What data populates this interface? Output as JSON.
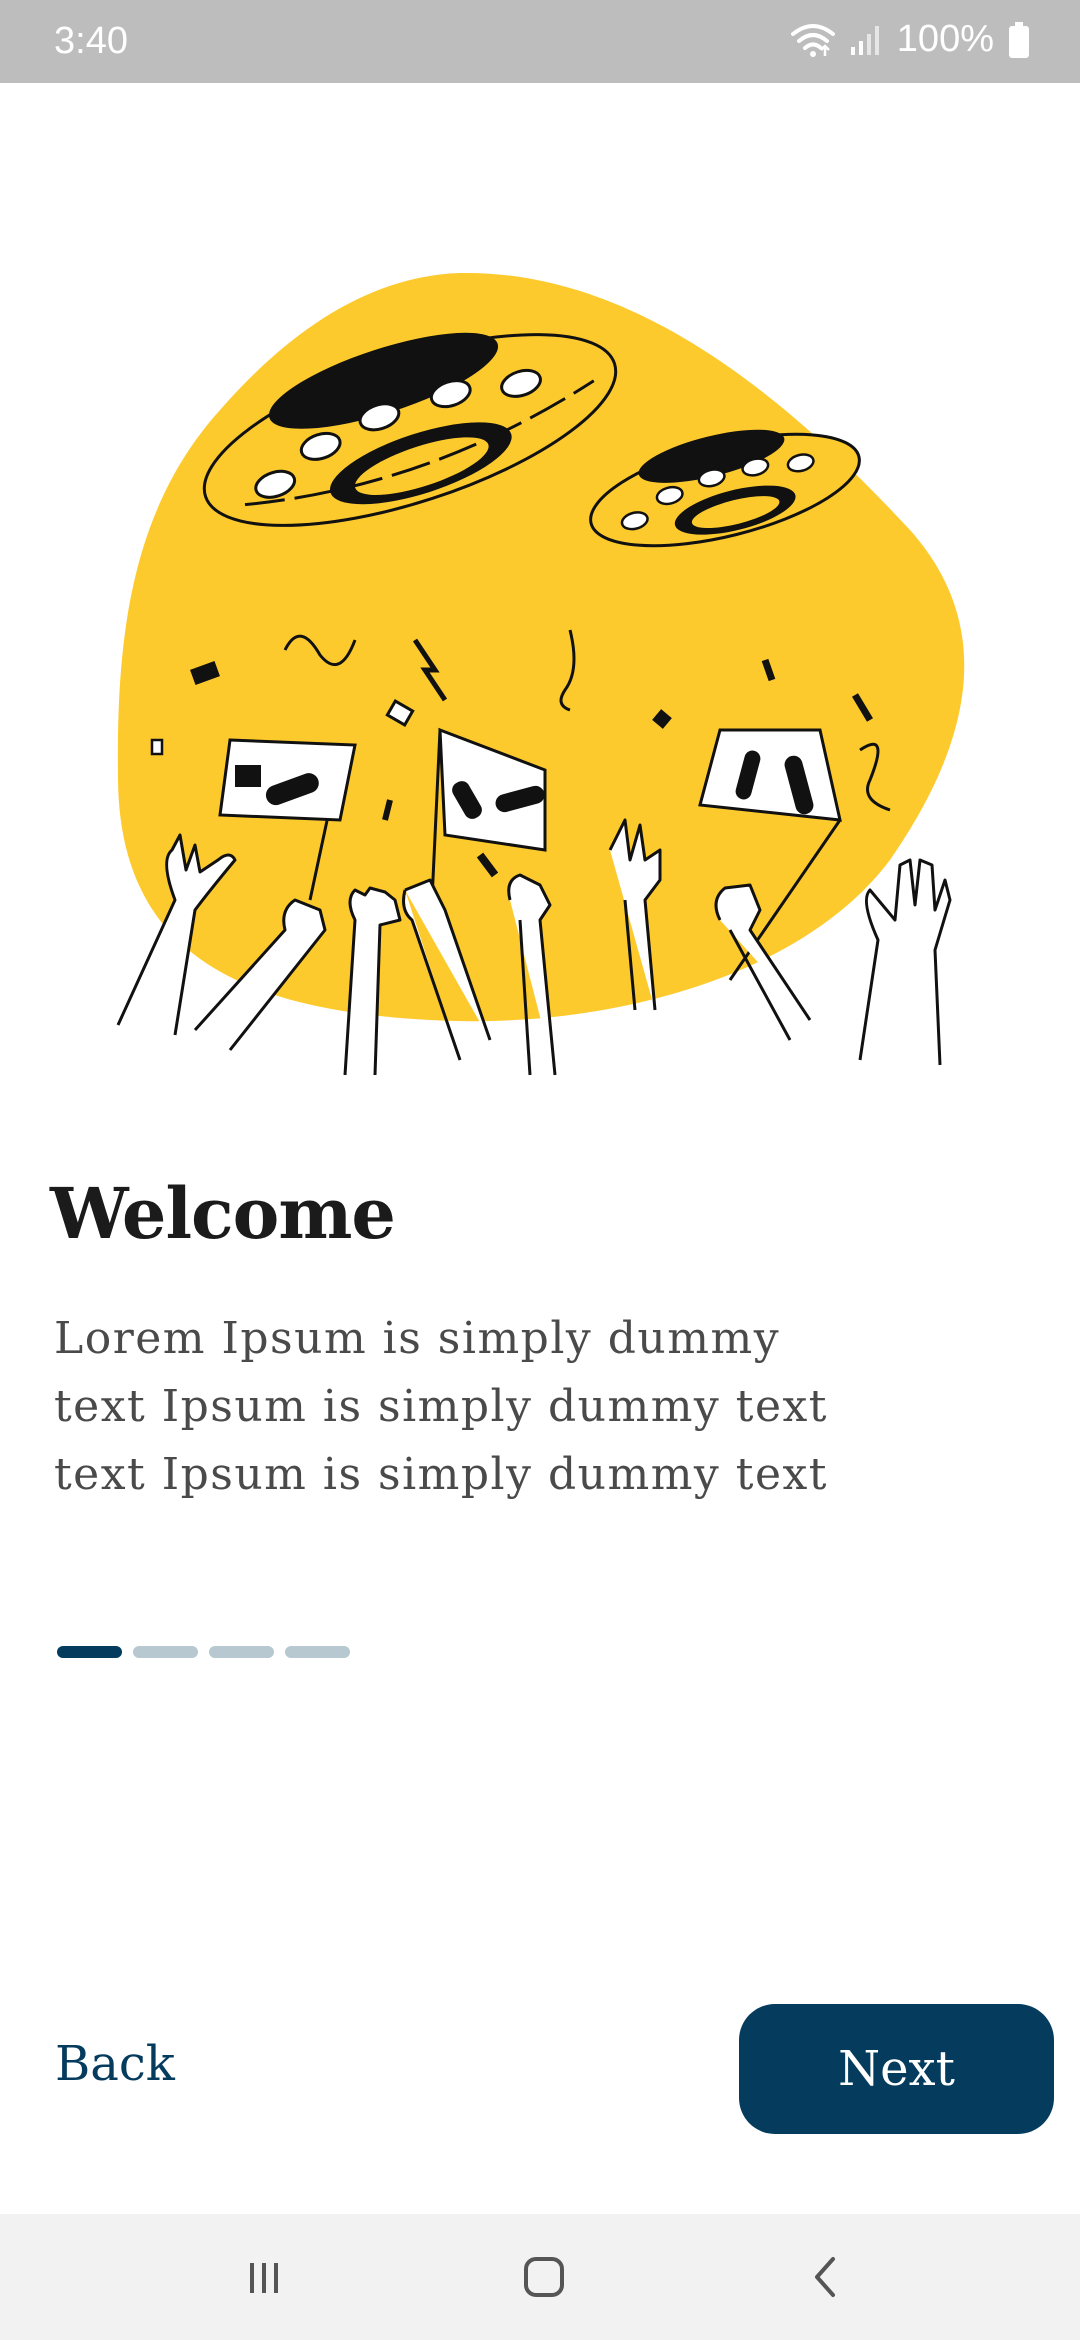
{
  "status_bar": {
    "time": "3:40",
    "battery": "100%",
    "icons": [
      "wifi-icon",
      "signal-icon",
      "battery-icon"
    ]
  },
  "onboarding": {
    "illustration": "ufo-celebration-illustration",
    "title": "Welcome",
    "body": "Lorem Ipsum is simply dummy\ntext Ipsum is simply dummy text\ntext Ipsum is simply dummy text",
    "pager": {
      "total": 4,
      "current": 1
    }
  },
  "actions": {
    "back_label": "Back",
    "next_label": "Next"
  },
  "nav_bar": {
    "icons": [
      "recent-apps-icon",
      "home-icon",
      "back-icon"
    ]
  },
  "colors": {
    "primary": "#053c5e",
    "accent_yellow": "#fdca2e",
    "pager_inactive": "#b8c8d1",
    "status_bar": "#bdbdbd"
  }
}
